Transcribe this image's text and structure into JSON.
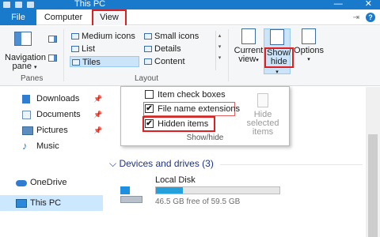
{
  "window": {
    "title": "This PC",
    "minimize_glyph": "—",
    "close_glyph": "✕"
  },
  "tabs": {
    "file": "File",
    "computer": "Computer",
    "view": "View"
  },
  "ribbon": {
    "panes": {
      "navigation_pane_line1": "Navigation",
      "navigation_pane_line2": "pane",
      "caret": "▾",
      "group_label": "Panes"
    },
    "layout": {
      "items": [
        "Medium icons",
        "Small icons",
        "List",
        "Details",
        "Tiles",
        "Content"
      ],
      "selected": "Tiles",
      "group_label": "Layout"
    },
    "current_view": {
      "line1": "Current",
      "line2": "view"
    },
    "show_hide": {
      "line1": "Show/",
      "line2": "hide"
    },
    "options": {
      "label": "Options"
    }
  },
  "show_hide_dropdown": {
    "item_check_boxes": {
      "label": "Item check boxes",
      "checked": false
    },
    "file_name_extensions": {
      "label": "File name extensions",
      "checked": true
    },
    "hidden_items": {
      "label": "Hidden items",
      "checked": true
    },
    "hide_selected_line1": "Hide selected",
    "hide_selected_line2": "items",
    "group_label": "Show/hide",
    "check_glyph": "✔"
  },
  "nav": {
    "items": [
      "Downloads",
      "Documents",
      "Pictures",
      "Music",
      "OneDrive",
      "This PC"
    ],
    "selected": "This PC"
  },
  "main": {
    "section_header": "Devices and drives (3)",
    "section_chevron": "⌵",
    "drive": {
      "name": "Local Disk",
      "free_text": "46.5 GB free of 59.5 GB",
      "used_fraction": 0.22
    }
  },
  "colors": {
    "accent": "#1979ca",
    "highlight": "#e02020",
    "drive_bar": "#26a0da"
  }
}
